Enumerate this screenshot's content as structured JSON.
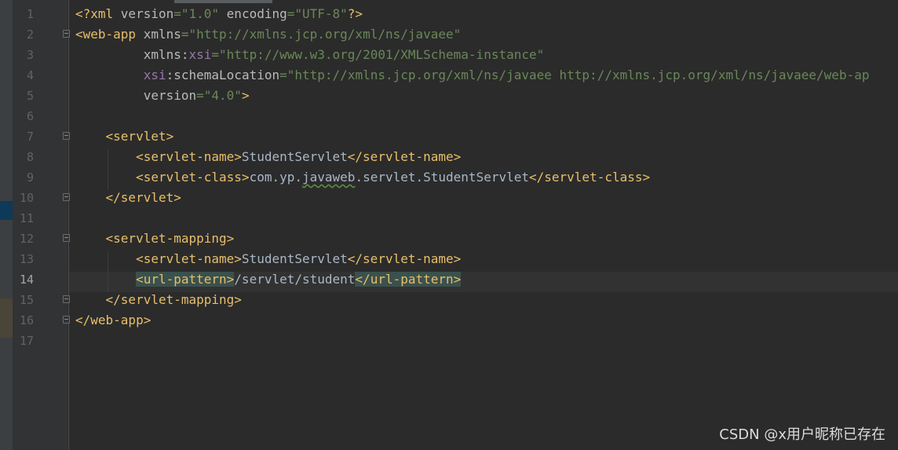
{
  "colors": {
    "background": "#2b2b2b",
    "gutter": "#313335",
    "tag": "#e8bf6a",
    "attribute": "#bababa",
    "value": "#6a8759",
    "namespace": "#9876aa",
    "text": "#a9b7c6",
    "match_highlight": "#3b514d"
  },
  "editor": {
    "current_line": 14,
    "lines": [
      {
        "num": "1",
        "tokens": [
          {
            "t": "tag",
            "v": "<?xml "
          },
          {
            "t": "attr",
            "v": "version"
          },
          {
            "t": "val",
            "v": "=\"1.0\" "
          },
          {
            "t": "attr",
            "v": "encoding"
          },
          {
            "t": "val",
            "v": "=\"UTF-8\""
          },
          {
            "t": "tag",
            "v": "?>"
          }
        ]
      },
      {
        "num": "2",
        "tokens": [
          {
            "t": "tag",
            "v": "<web-app "
          },
          {
            "t": "attr",
            "v": "xmlns"
          },
          {
            "t": "val",
            "v": "=\"http://xmlns.jcp.org/xml/ns/javaee\""
          }
        ]
      },
      {
        "num": "3",
        "tokens": [
          {
            "t": "text",
            "v": "         "
          },
          {
            "t": "attr",
            "v": "xmlns:"
          },
          {
            "t": "ns",
            "v": "xsi"
          },
          {
            "t": "val",
            "v": "=\"http://www.w3.org/2001/XMLSchema-instance\""
          }
        ]
      },
      {
        "num": "4",
        "tokens": [
          {
            "t": "text",
            "v": "         "
          },
          {
            "t": "ns",
            "v": "xsi"
          },
          {
            "t": "attr",
            "v": ":schemaLocation"
          },
          {
            "t": "val",
            "v": "=\"http://xmlns.jcp.org/xml/ns/javaee http://xmlns.jcp.org/xml/ns/javaee/web-ap"
          }
        ]
      },
      {
        "num": "5",
        "tokens": [
          {
            "t": "text",
            "v": "         "
          },
          {
            "t": "attr",
            "v": "version"
          },
          {
            "t": "val",
            "v": "=\"4.0\""
          },
          {
            "t": "tag",
            "v": ">"
          }
        ]
      },
      {
        "num": "6",
        "tokens": []
      },
      {
        "num": "7",
        "tokens": [
          {
            "t": "text",
            "v": "    "
          },
          {
            "t": "tag",
            "v": "<servlet>"
          }
        ]
      },
      {
        "num": "8",
        "tokens": [
          {
            "t": "text",
            "v": "        "
          },
          {
            "t": "tag",
            "v": "<servlet-name>"
          },
          {
            "t": "text",
            "v": "StudentServlet"
          },
          {
            "t": "tag",
            "v": "</servlet-name>"
          }
        ]
      },
      {
        "num": "9",
        "tokens": [
          {
            "t": "text",
            "v": "        "
          },
          {
            "t": "tag",
            "v": "<servlet-class>"
          },
          {
            "t": "text",
            "v": "com.yp."
          },
          {
            "t": "typo",
            "v": "javaweb"
          },
          {
            "t": "text",
            "v": ".servlet.StudentServlet"
          },
          {
            "t": "tag",
            "v": "</servlet-class>"
          }
        ]
      },
      {
        "num": "10",
        "tokens": [
          {
            "t": "text",
            "v": "    "
          },
          {
            "t": "tag",
            "v": "</servlet>"
          }
        ]
      },
      {
        "num": "11",
        "tokens": []
      },
      {
        "num": "12",
        "tokens": [
          {
            "t": "text",
            "v": "    "
          },
          {
            "t": "tag",
            "v": "<servlet-mapping>"
          }
        ]
      },
      {
        "num": "13",
        "tokens": [
          {
            "t": "text",
            "v": "        "
          },
          {
            "t": "tag",
            "v": "<servlet-name>"
          },
          {
            "t": "text",
            "v": "StudentServlet"
          },
          {
            "t": "tag",
            "v": "</servlet-name>"
          }
        ]
      },
      {
        "num": "14",
        "tokens": [
          {
            "t": "text",
            "v": "        "
          },
          {
            "t": "tagmatch",
            "v": "<url-pattern>"
          },
          {
            "t": "text",
            "v": "/servlet/student"
          },
          {
            "t": "tagmatch",
            "v": "</url-pattern>"
          }
        ]
      },
      {
        "num": "15",
        "tokens": [
          {
            "t": "text",
            "v": "    "
          },
          {
            "t": "tag",
            "v": "</servlet-mapping>"
          }
        ]
      },
      {
        "num": "16",
        "tokens": [
          {
            "t": "tag",
            "v": "</web-app>"
          }
        ]
      },
      {
        "num": "17",
        "tokens": []
      }
    ]
  },
  "watermark": "CSDN @x用户昵称已存在"
}
